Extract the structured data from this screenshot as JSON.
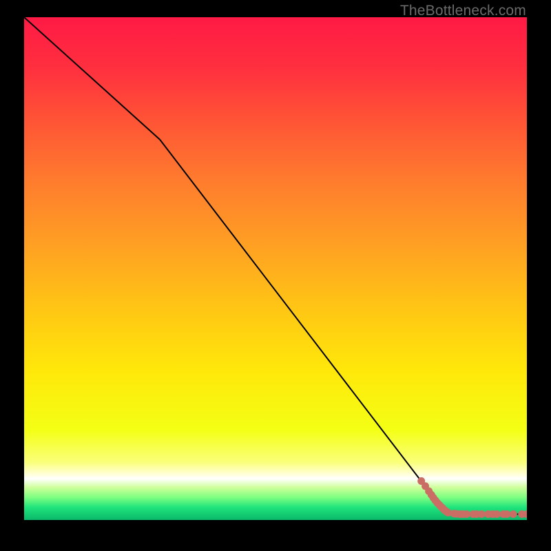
{
  "watermark": "TheBottleneck.com",
  "colors": {
    "line": "#000000",
    "marker_fill": "#c96d65",
    "marker_stroke": "#c96d65",
    "background": "#000000"
  },
  "gradient_stops": [
    {
      "offset": 0.0,
      "color": "#ff1a45"
    },
    {
      "offset": 0.1,
      "color": "#ff2f3f"
    },
    {
      "offset": 0.2,
      "color": "#ff5236"
    },
    {
      "offset": 0.32,
      "color": "#ff7a2e"
    },
    {
      "offset": 0.45,
      "color": "#ff9f23"
    },
    {
      "offset": 0.58,
      "color": "#ffc614"
    },
    {
      "offset": 0.7,
      "color": "#ffe70a"
    },
    {
      "offset": 0.82,
      "color": "#f4ff14"
    },
    {
      "offset": 0.885,
      "color": "#faff7a"
    },
    {
      "offset": 0.905,
      "color": "#ffffc8"
    },
    {
      "offset": 0.918,
      "color": "#ffffff"
    },
    {
      "offset": 0.935,
      "color": "#cfff9b"
    },
    {
      "offset": 0.955,
      "color": "#7dff81"
    },
    {
      "offset": 0.975,
      "color": "#1fe37c"
    },
    {
      "offset": 1.0,
      "color": "#0bb86a"
    }
  ],
  "chart_data": {
    "type": "line",
    "title": "",
    "xlabel": "",
    "ylabel": "",
    "xlim": [
      0,
      100
    ],
    "ylim": [
      0,
      100
    ],
    "series": [
      {
        "name": "curve",
        "style": "solid-line",
        "x": [
          0,
          27,
          84,
          100
        ],
        "y": [
          100,
          76,
          2.5,
          2.5
        ]
      },
      {
        "name": "markers",
        "style": "dots",
        "x": [
          79,
          79.8,
          80.5,
          81,
          81.4,
          81.8,
          82.2,
          82.6,
          83,
          83.3,
          83.6,
          84,
          84.3,
          85.5,
          86,
          86.7,
          87.3,
          88,
          89.3,
          90,
          91,
          92.3,
          93.2,
          94,
          95.3,
          96,
          97.3,
          99,
          100
        ],
        "y": [
          9,
          8,
          7,
          6.3,
          5.7,
          5.2,
          4.7,
          4.3,
          3.9,
          3.6,
          3.3,
          3,
          2.8,
          2.6,
          2.55,
          2.5,
          2.5,
          2.5,
          2.5,
          2.5,
          2.5,
          2.5,
          2.5,
          2.5,
          2.5,
          2.5,
          2.5,
          2.5,
          2.5
        ]
      }
    ]
  }
}
